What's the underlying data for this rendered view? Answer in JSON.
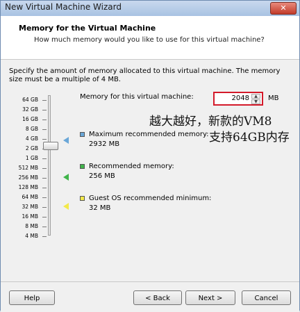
{
  "window": {
    "title": "New Virtual Machine Wizard"
  },
  "header": {
    "title": "Memory for the Virtual Machine",
    "subtitle": "How much memory would you like to use for this virtual machine?"
  },
  "description": "Specify the amount of memory allocated to this virtual machine. The memory size must be a multiple of 4 MB.",
  "scale_labels": [
    "64 GB",
    "32 GB",
    "16 GB",
    "8 GB",
    "4 GB",
    "2 GB",
    "1 GB",
    "512 MB",
    "256 MB",
    "128 MB",
    "64 MB",
    "32 MB",
    "16 MB",
    "8 MB",
    "4 MB"
  ],
  "memory_field": {
    "label": "Memory for this virtual machine:",
    "value": "2048",
    "unit": "MB"
  },
  "recommendations": [
    {
      "label": "Maximum recommended memory:",
      "value": "2932 MB",
      "color": "#6aa7d8"
    },
    {
      "label": "Recommended memory:",
      "value": "256 MB",
      "color": "#41b54b"
    },
    {
      "label": "Guest OS recommended minimum:",
      "value": "32 MB",
      "color": "#f3e94a"
    }
  ],
  "annotations": [
    "越大越好，新款的VM8",
    "支持64GB内存"
  ],
  "buttons": {
    "help": "Help",
    "back": "< Back",
    "next": "Next >",
    "cancel": "Cancel"
  },
  "colors": {
    "highlight_border": "#d41a2a",
    "title_bar": "#b9cfea"
  }
}
